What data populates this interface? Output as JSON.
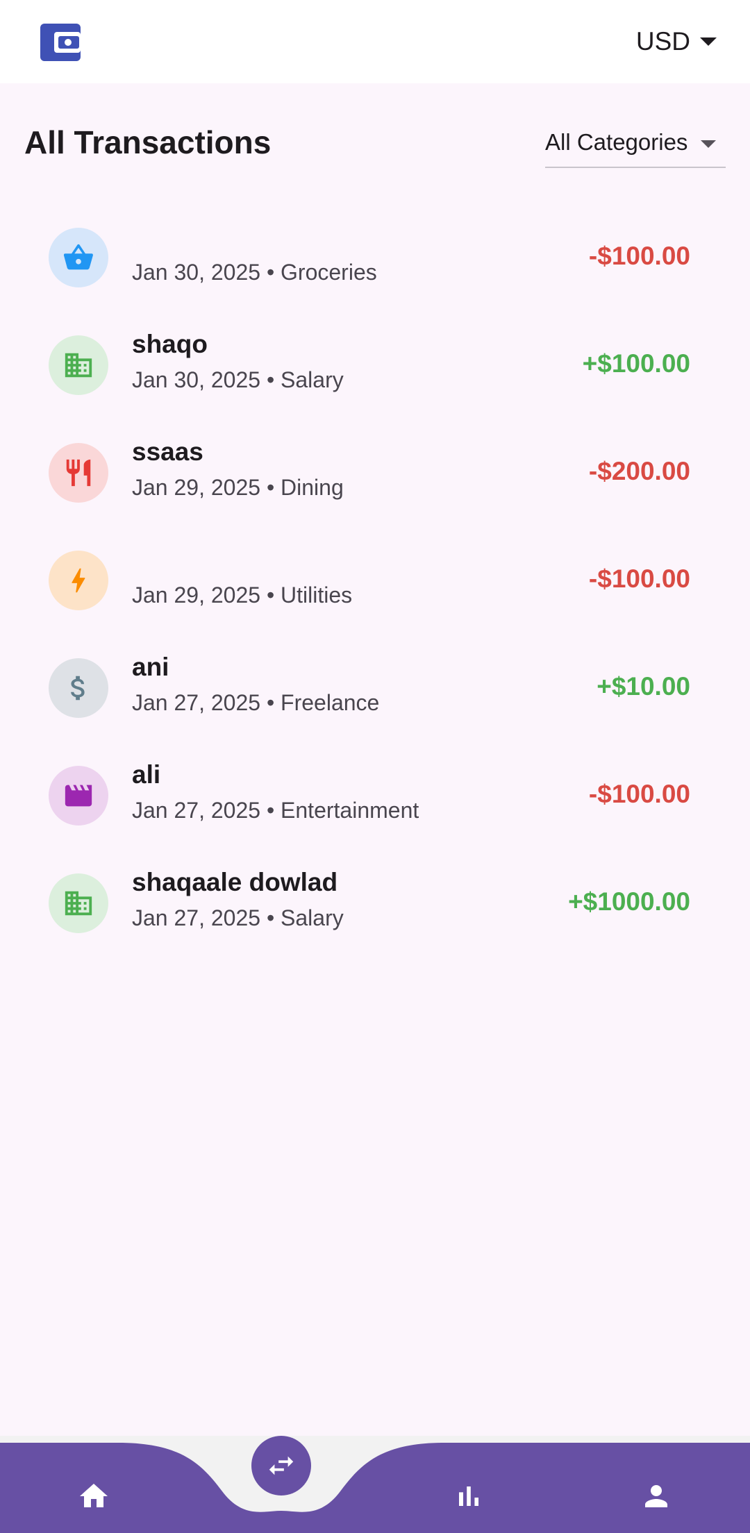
{
  "appbar": {
    "logo_icon": "wallet-icon",
    "currency": "USD"
  },
  "header": {
    "title": "All Transactions",
    "category_filter": "All Categories"
  },
  "colors": {
    "expense": "#D94A43",
    "income": "#4CAF50",
    "nav": "#6750A4"
  },
  "transactions": [
    {
      "name": "",
      "subtitle": "Jan 30, 2025 • Groceries",
      "amount": "-$100.00",
      "icon": "shopping-basket-icon"
    },
    {
      "name": "shaqo",
      "subtitle": "Jan 30, 2025 • Salary",
      "amount": "+$100.00",
      "icon": "building-icon"
    },
    {
      "name": "ssaas",
      "subtitle": "Jan 29, 2025 • Dining",
      "amount": "-$200.00",
      "icon": "restaurant-icon"
    },
    {
      "name": "",
      "subtitle": "Jan 29, 2025 • Utilities",
      "amount": "-$100.00",
      "icon": "bolt-icon"
    },
    {
      "name": "ani",
      "subtitle": "Jan 27, 2025 • Freelance",
      "amount": "+$10.00",
      "icon": "dollar-icon"
    },
    {
      "name": "ali",
      "subtitle": "Jan 27, 2025 • Entertainment",
      "amount": "-$100.00",
      "icon": "movie-icon"
    },
    {
      "name": "shaqaale dowlad",
      "subtitle": "Jan 27, 2025 • Salary",
      "amount": "+$1000.00",
      "icon": "building-icon"
    }
  ],
  "bottom_nav": {
    "items": [
      "home-icon",
      "transfer-icon",
      "bar-chart-icon",
      "person-icon"
    ]
  }
}
